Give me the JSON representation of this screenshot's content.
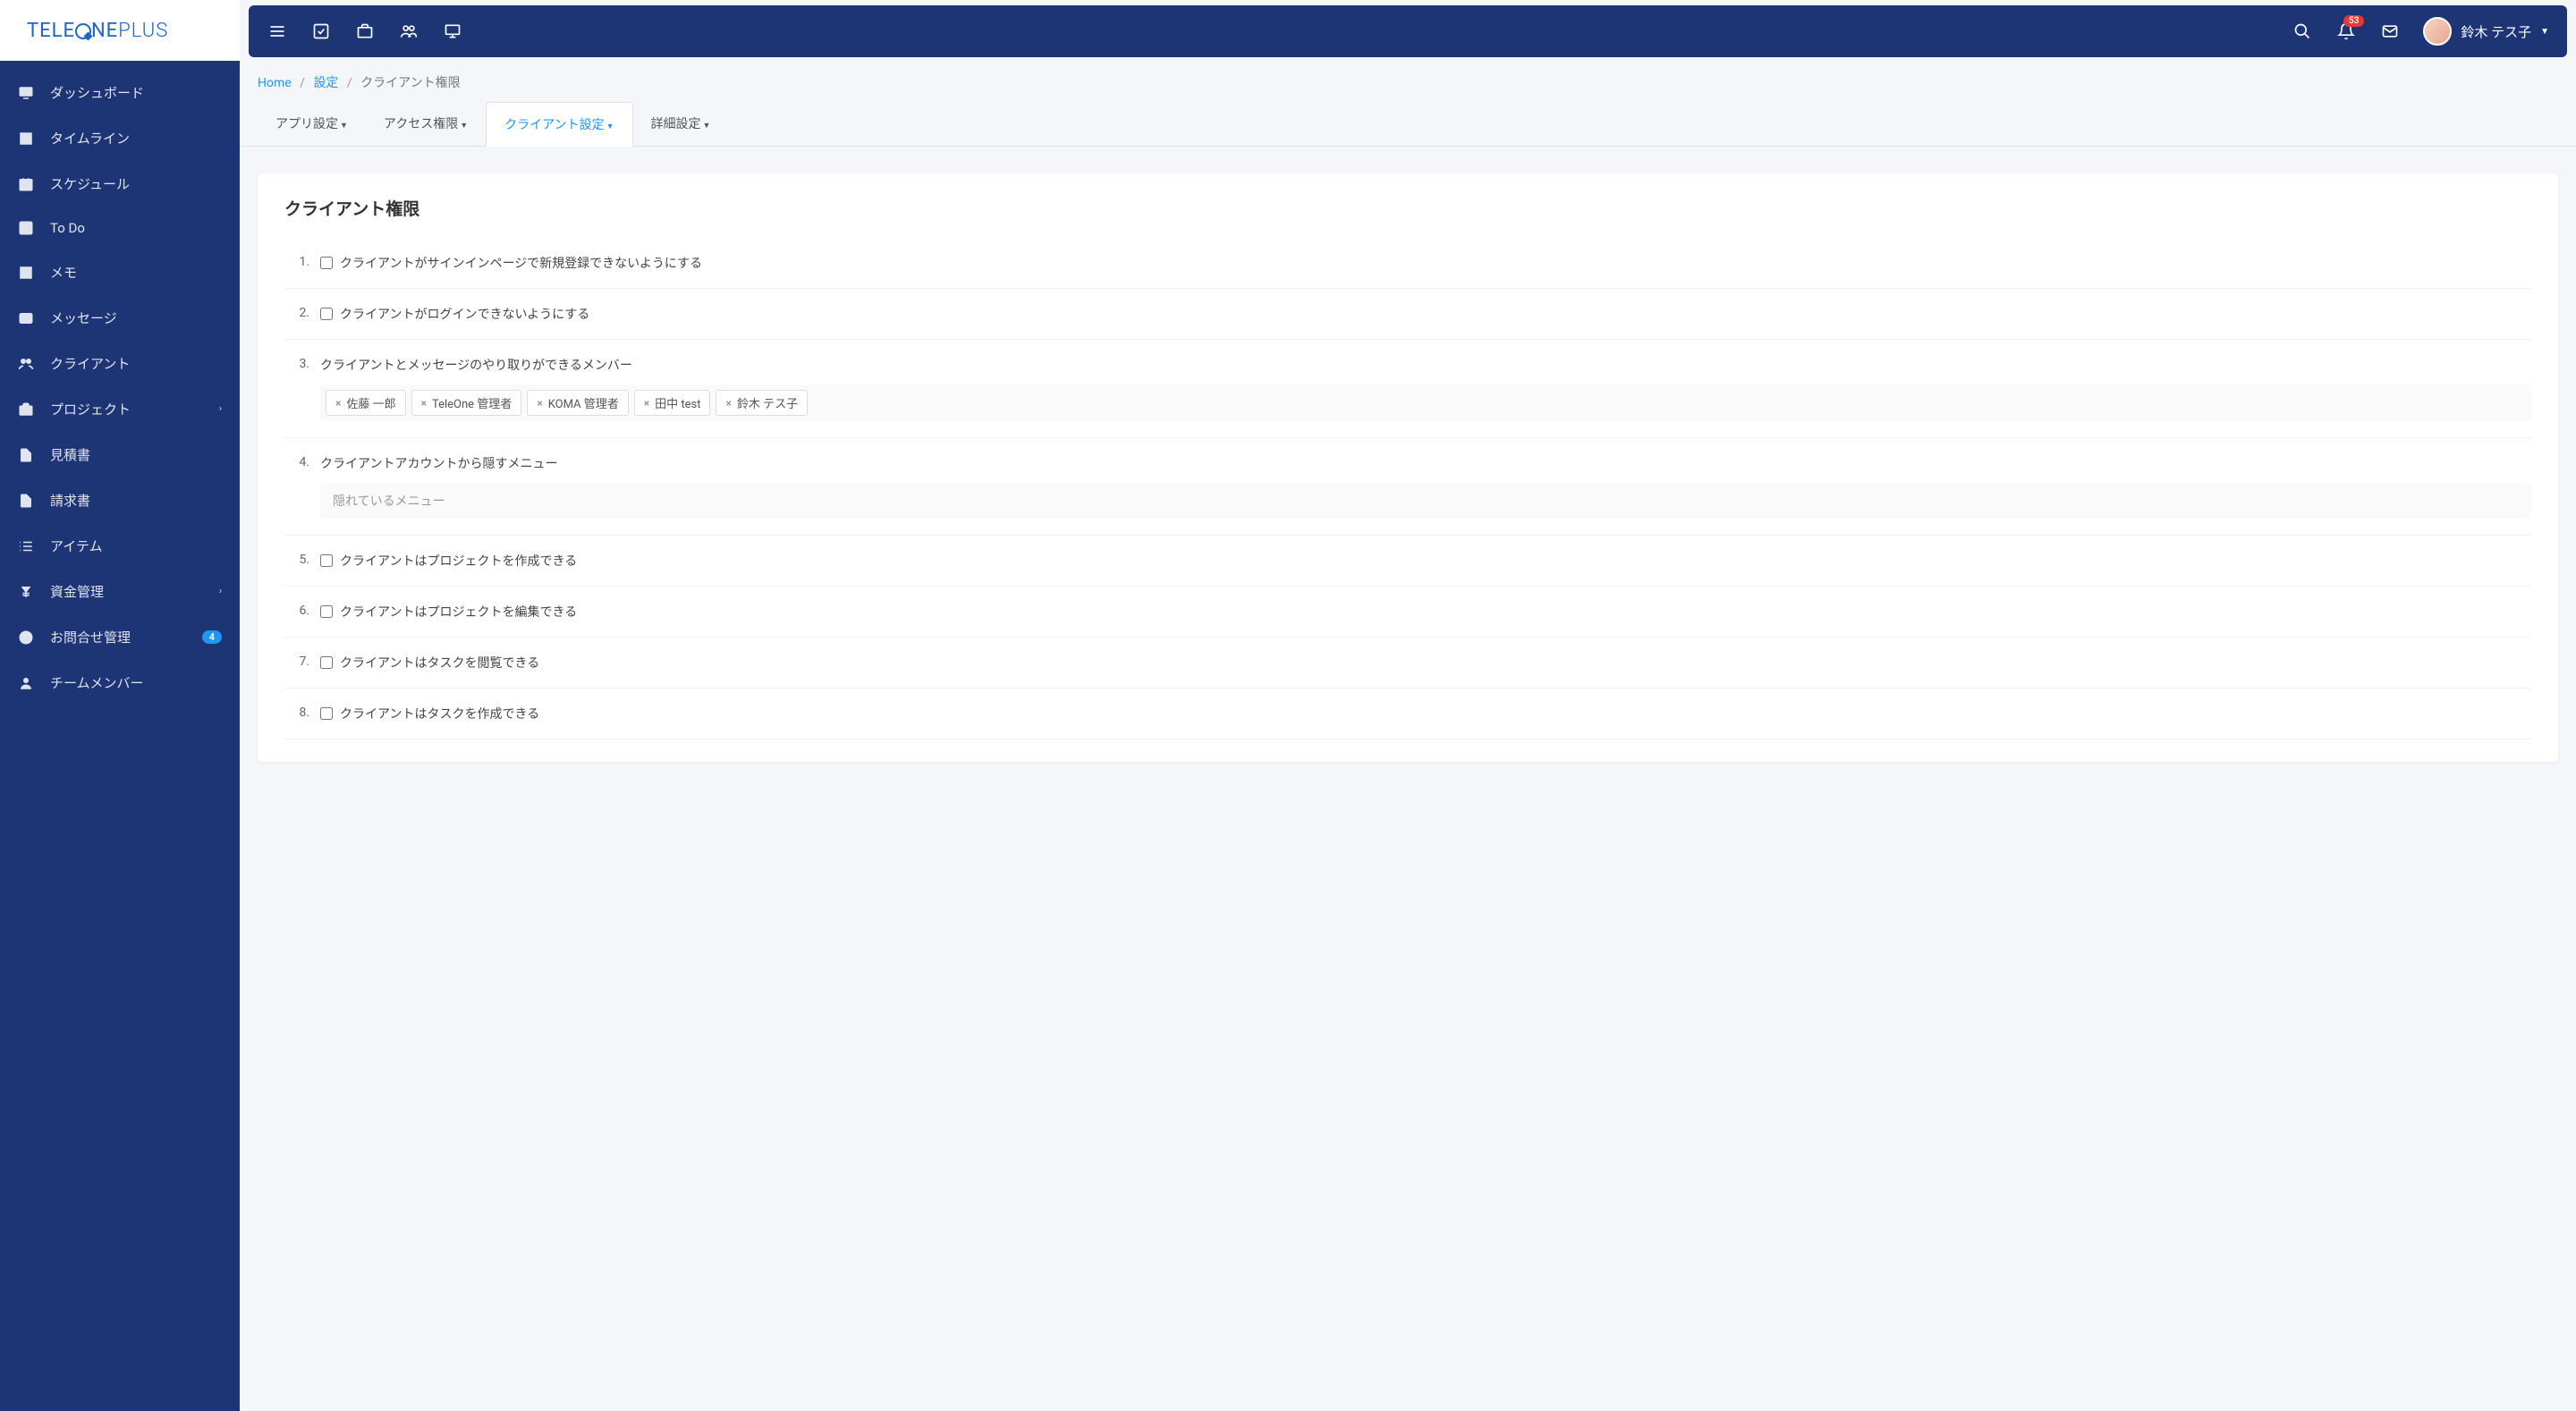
{
  "logo": "TELEONEPLUS",
  "user": {
    "name": "鈴木 テス子"
  },
  "notif_count": "53",
  "sidebar": {
    "items": [
      {
        "label": "ダッシュボード",
        "icon": "dashboard"
      },
      {
        "label": "タイムライン",
        "icon": "timeline"
      },
      {
        "label": "スケジュール",
        "icon": "calendar"
      },
      {
        "label": "To Do",
        "icon": "check"
      },
      {
        "label": "メモ",
        "icon": "note"
      },
      {
        "label": "メッセージ",
        "icon": "mail"
      },
      {
        "label": "クライアント",
        "icon": "users"
      },
      {
        "label": "プロジェクト",
        "icon": "briefcase",
        "chevron": true
      },
      {
        "label": "見積書",
        "icon": "file"
      },
      {
        "label": "請求書",
        "icon": "file"
      },
      {
        "label": "アイテム",
        "icon": "list"
      },
      {
        "label": "資金管理",
        "icon": "yen",
        "chevron": true
      },
      {
        "label": "お問合せ管理",
        "icon": "support",
        "badge": "4"
      },
      {
        "label": "チームメンバー",
        "icon": "user"
      }
    ]
  },
  "breadcrumb": {
    "home": "Home",
    "settings": "設定",
    "current": "クライアント権限"
  },
  "tabs": [
    {
      "label": "アプリ設定"
    },
    {
      "label": "アクセス権限"
    },
    {
      "label": "クライアント設定",
      "active": true
    },
    {
      "label": "詳細設定"
    }
  ],
  "card": {
    "title": "クライアント権限",
    "rows": [
      {
        "num": "1.",
        "type": "check",
        "label": "クライアントがサインインページで新規登録できないようにする"
      },
      {
        "num": "2.",
        "type": "check",
        "label": "クライアントがログインできないようにする"
      },
      {
        "num": "3.",
        "type": "tags",
        "label": "クライアントとメッセージのやり取りができるメンバー",
        "tags": [
          "佐藤 一郎",
          "TeleOne 管理者",
          "KOMA 管理者",
          "田中 test",
          "鈴木 テス子"
        ]
      },
      {
        "num": "4.",
        "type": "input",
        "label": "クライアントアカウントから隠すメニュー",
        "placeholder": "隠れているメニュー"
      },
      {
        "num": "5.",
        "type": "check",
        "label": "クライアントはプロジェクトを作成できる"
      },
      {
        "num": "6.",
        "type": "check",
        "label": "クライアントはプロジェクトを編集できる"
      },
      {
        "num": "7.",
        "type": "check",
        "label": "クライアントはタスクを閲覧できる"
      },
      {
        "num": "8.",
        "type": "check",
        "label": "クライアントはタスクを作成できる"
      }
    ]
  }
}
